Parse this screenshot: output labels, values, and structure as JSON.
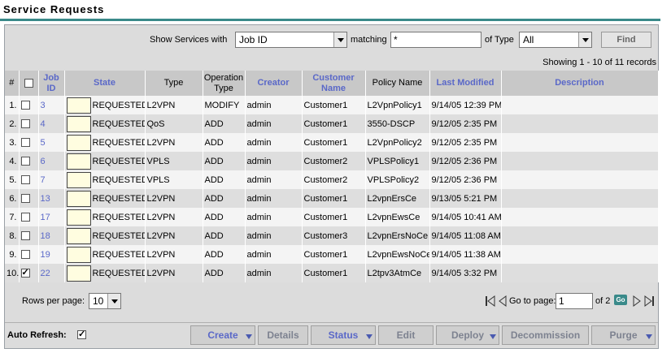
{
  "page": {
    "title": "Service Requests",
    "figure_id": "138515"
  },
  "filter": {
    "show_label": "Show Services with",
    "field_value": "Job ID",
    "matching_label": "matching",
    "matching_value": "*",
    "type_label": "of Type",
    "type_value": "All",
    "find_label": "Find"
  },
  "showing_text": "Showing 1 - 10 of 11 records",
  "columns": {
    "num": "#",
    "job_id": "Job ID",
    "state": "State",
    "type": "Type",
    "op_type": "Operation Type",
    "creator": "Creator",
    "customer": "Customer Name",
    "policy": "Policy Name",
    "modified": "Last Modified",
    "description": "Description"
  },
  "rows": [
    {
      "num": "1.",
      "checked": false,
      "job": "3",
      "state": "REQUESTED",
      "type": "L2VPN",
      "op": "MODIFY",
      "creator": "admin",
      "customer": "Customer1",
      "policy": "L2VpnPolicy1",
      "modified": "9/14/05 12:39 PM",
      "description": ""
    },
    {
      "num": "2.",
      "checked": false,
      "job": "4",
      "state": "REQUESTED",
      "type": "QoS",
      "op": "ADD",
      "creator": "admin",
      "customer": "Customer1",
      "policy": "3550-DSCP",
      "modified": "9/12/05 2:35 PM",
      "description": ""
    },
    {
      "num": "3.",
      "checked": false,
      "job": "5",
      "state": "REQUESTED",
      "type": "L2VPN",
      "op": "ADD",
      "creator": "admin",
      "customer": "Customer1",
      "policy": "L2VpnPolicy2",
      "modified": "9/12/05 2:35 PM",
      "description": ""
    },
    {
      "num": "4.",
      "checked": false,
      "job": "6",
      "state": "REQUESTED",
      "type": "VPLS",
      "op": "ADD",
      "creator": "admin",
      "customer": "Customer2",
      "policy": "VPLSPolicy1",
      "modified": "9/12/05 2:36 PM",
      "description": ""
    },
    {
      "num": "5.",
      "checked": false,
      "job": "7",
      "state": "REQUESTED",
      "type": "VPLS",
      "op": "ADD",
      "creator": "admin",
      "customer": "Customer2",
      "policy": "VPLSPolicy2",
      "modified": "9/12/05 2:36 PM",
      "description": ""
    },
    {
      "num": "6.",
      "checked": false,
      "job": "13",
      "state": "REQUESTED",
      "type": "L2VPN",
      "op": "ADD",
      "creator": "admin",
      "customer": "Customer1",
      "policy": "L2vpnErsCe",
      "modified": "9/13/05 5:21 PM",
      "description": ""
    },
    {
      "num": "7.",
      "checked": false,
      "job": "17",
      "state": "REQUESTED",
      "type": "L2VPN",
      "op": "ADD",
      "creator": "admin",
      "customer": "Customer1",
      "policy": "L2vpnEwsCe",
      "modified": "9/14/05 10:41 AM",
      "description": ""
    },
    {
      "num": "8.",
      "checked": false,
      "job": "18",
      "state": "REQUESTED",
      "type": "L2VPN",
      "op": "ADD",
      "creator": "admin",
      "customer": "Customer3",
      "policy": "L2vpnErsNoCe",
      "modified": "9/14/05 11:08 AM",
      "description": ""
    },
    {
      "num": "9.",
      "checked": false,
      "job": "19",
      "state": "REQUESTED",
      "type": "L2VPN",
      "op": "ADD",
      "creator": "admin",
      "customer": "Customer1",
      "policy": "L2vpnEwsNoCe",
      "modified": "9/14/05 11:38 AM",
      "description": ""
    },
    {
      "num": "10.",
      "checked": true,
      "job": "22",
      "state": "REQUESTED",
      "type": "L2VPN",
      "op": "ADD",
      "creator": "admin",
      "customer": "Customer1",
      "policy": "L2tpv3AtmCe",
      "modified": "9/14/05 3:32 PM",
      "description": ""
    }
  ],
  "pager": {
    "rows_label": "Rows per page:",
    "rows_value": "10",
    "goto_label": "Go to page:",
    "page_value": "1",
    "of_label": "of 2",
    "go_label": "Go"
  },
  "actions": {
    "auto_refresh_label": "Auto Refresh:",
    "auto_refresh_checked": true,
    "create": "Create",
    "details": "Details",
    "status": "Status",
    "edit": "Edit",
    "deploy": "Deploy",
    "decommission": "Decommission",
    "purge": "Purge"
  },
  "colors": {
    "accent_teal": "#3a8a8a",
    "link_blue": "#5a68c8",
    "header_gray": "#c8c8c8",
    "state_yellow": "#fffde0"
  }
}
